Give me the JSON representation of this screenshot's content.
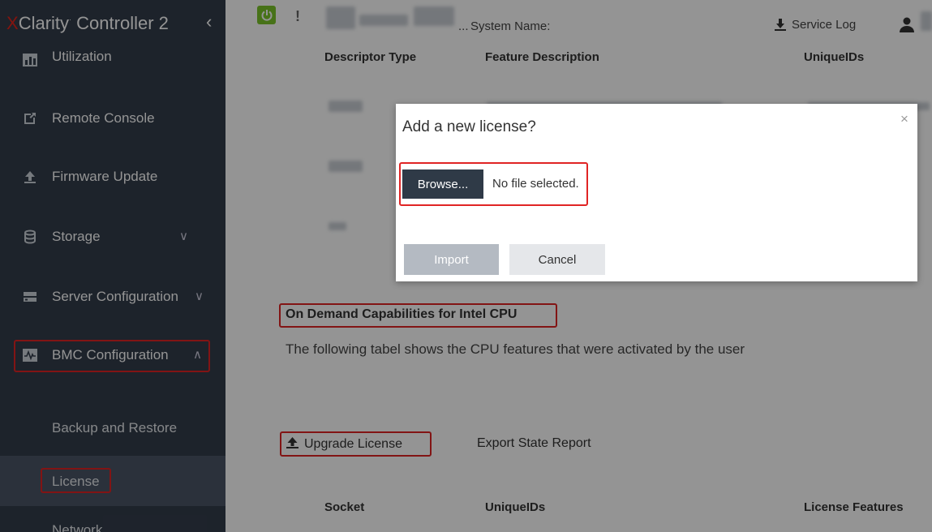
{
  "brand": {
    "x": "X",
    "clarity": "Clarity",
    "tm": "·",
    "product": "Controller 2",
    "collapse": "‹"
  },
  "sidebar": {
    "items": [
      {
        "label": "Utilization",
        "icon": "bar-chart-icon"
      },
      {
        "label": "Remote Console",
        "icon": "external-window-icon"
      },
      {
        "label": "Firmware Update",
        "icon": "upload-icon"
      },
      {
        "label": "Storage",
        "icon": "database-icon",
        "caret": "∨"
      },
      {
        "label": "Server Configuration",
        "icon": "server-icon",
        "caret": "∨"
      },
      {
        "label": "BMC Configuration",
        "icon": "pulse-icon",
        "caret": "∧"
      }
    ],
    "subitems": [
      {
        "label": "Backup and Restore"
      },
      {
        "label": "License",
        "selected": true
      },
      {
        "label": "Network"
      }
    ]
  },
  "topbar": {
    "alert_glyph": "!",
    "ellipsis": "...",
    "system_name_label": "System Name:",
    "service_log_label": "Service Log"
  },
  "main": {
    "top_table_headers": [
      "Descriptor Type",
      "Feature Description",
      "UniqueIDs"
    ],
    "ondemand_title": "On Demand Capabilities for Intel CPU",
    "ondemand_desc": "The following tabel shows the CPU features that were activated by the user",
    "upgrade_license_label": "Upgrade License",
    "export_report_label": "Export State Report",
    "bottom_table_headers": [
      "Socket",
      "UniqueIDs",
      "License Features"
    ]
  },
  "modal": {
    "title": "Add a new license?",
    "close_glyph": "×",
    "browse_label": "Browse...",
    "file_status": "No file selected.",
    "import_label": "Import",
    "cancel_label": "Cancel"
  },
  "colors": {
    "sidebar_bg": "#333d4b",
    "selected_bg": "#4a5566",
    "highlight": "#e02424",
    "power_green": "#7bc42a",
    "brand_red": "#e2231a"
  }
}
